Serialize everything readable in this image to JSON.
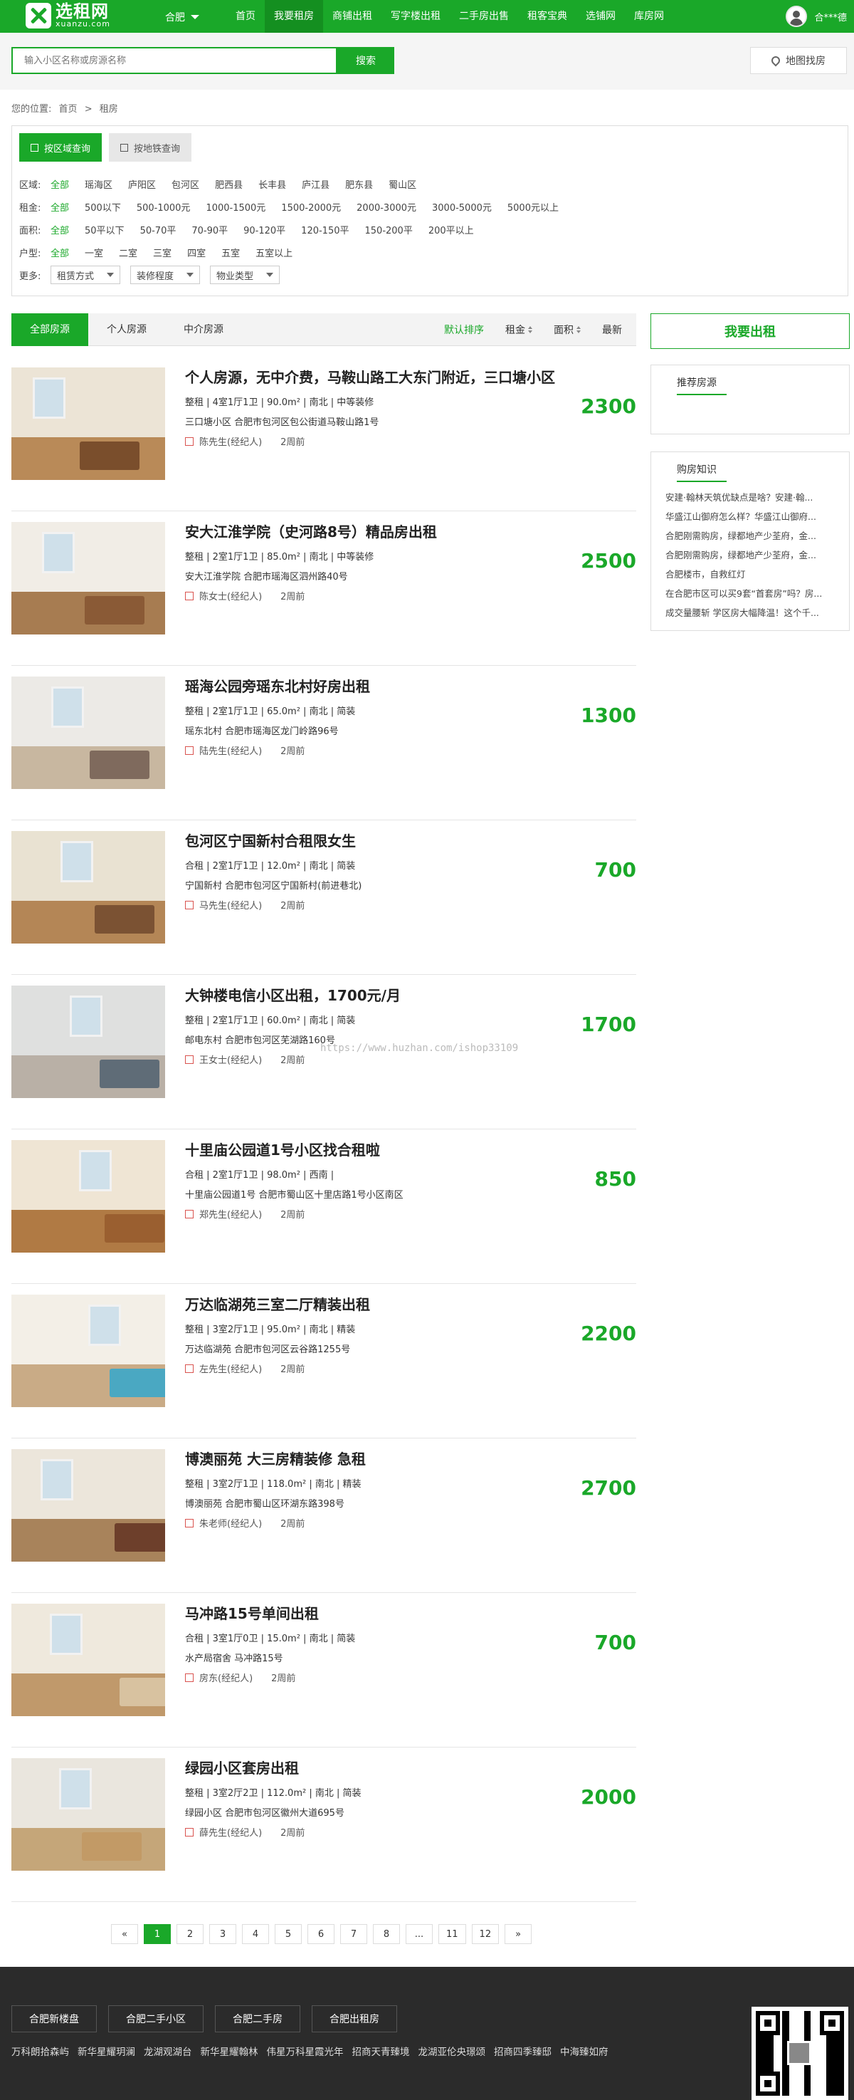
{
  "header": {
    "logo_text": "选租网",
    "logo_domain": "xuanzu.com",
    "city": "合肥",
    "nav": [
      "首页",
      "我要租房",
      "商铺出租",
      "写字楼出租",
      "二手房出售",
      "租客宝典",
      "选铺网",
      "库房网"
    ],
    "active_nav": 1,
    "user_name": "合***德"
  },
  "search": {
    "placeholder": "输入小区名称或房源名称",
    "button": "搜索",
    "map_button": "地图找房"
  },
  "breadcrumb": {
    "prefix": "您的位置:",
    "home": "首页",
    "sep": ">",
    "current": "租房"
  },
  "filter": {
    "tabs": [
      "按区域查询",
      "按地铁查询"
    ],
    "rows": [
      {
        "label": "区域:",
        "options": [
          "全部",
          "瑶海区",
          "庐阳区",
          "包河区",
          "肥西县",
          "长丰县",
          "庐江县",
          "肥东县",
          "蜀山区"
        ]
      },
      {
        "label": "租金:",
        "options": [
          "全部",
          "500以下",
          "500-1000元",
          "1000-1500元",
          "1500-2000元",
          "2000-3000元",
          "3000-5000元",
          "5000元以上"
        ]
      },
      {
        "label": "面积:",
        "options": [
          "全部",
          "50平以下",
          "50-70平",
          "70-90平",
          "90-120平",
          "120-150平",
          "150-200平",
          "200平以上"
        ]
      },
      {
        "label": "户型:",
        "options": [
          "全部",
          "一室",
          "二室",
          "三室",
          "四室",
          "五室",
          "五室以上"
        ]
      }
    ],
    "more_label": "更多:",
    "selects": [
      "租赁方式",
      "装修程度",
      "物业类型"
    ]
  },
  "list_header": {
    "tabs": [
      "全部房源",
      "个人房源",
      "中介房源"
    ],
    "sorts": [
      "默认排序",
      "租金",
      "面积",
      "最新"
    ]
  },
  "listings": [
    {
      "title": "个人房源，无中介费，马鞍山路工大东门附近，三口塘小区",
      "meta": "整租 | 4室1厅1卫 | 90.0m² | 南北 | 中等装修",
      "addr": "三口塘小区 合肥市包河区包公街道马鞍山路1号",
      "agent": "陈先生(经纪人)",
      "time": "2周前",
      "price": "2300"
    },
    {
      "title": "安大江淮学院（史河路8号）精品房出租",
      "meta": "整租 | 2室1厅1卫 | 85.0m² | 南北 | 中等装修",
      "addr": "安大江淮学院 合肥市瑶海区泗州路40号",
      "agent": "陈女士(经纪人)",
      "time": "2周前",
      "price": "2500"
    },
    {
      "title": "瑶海公园旁瑶东北村好房出租",
      "meta": "整租 | 2室1厅1卫 | 65.0m² | 南北 | 简装",
      "addr": "瑶东北村 合肥市瑶海区龙门岭路96号",
      "agent": "陆先生(经纪人)",
      "time": "2周前",
      "price": "1300"
    },
    {
      "title": "包河区宁国新村合租限女生",
      "meta": "合租 | 2室1厅1卫 | 12.0m² | 南北 | 简装",
      "addr": "宁国新村 合肥市包河区宁国新村(前进巷北)",
      "agent": "马先生(经纪人)",
      "time": "2周前",
      "price": "700"
    },
    {
      "title": "大钟楼电信小区出租，1700元/月",
      "meta": "整租 | 2室1厅1卫 | 60.0m² | 南北 | 简装",
      "addr": "邮电东村 合肥市包河区芜湖路160号",
      "agent": "王女士(经纪人)",
      "time": "2周前",
      "price": "1700"
    },
    {
      "title": "十里庙公园道1号小区找合租啦",
      "meta": "合租 | 2室1厅1卫 | 98.0m² | 西南 |",
      "addr": "十里庙公园道1号 合肥市蜀山区十里店路1号小区南区",
      "agent": "郑先生(经纪人)",
      "time": "2周前",
      "price": "850"
    },
    {
      "title": "万达临湖苑三室二厅精装出租",
      "meta": "整租 | 3室2厅1卫 | 95.0m² | 南北 | 精装",
      "addr": "万达临湖苑 合肥市包河区云谷路1255号",
      "agent": "左先生(经纪人)",
      "time": "2周前",
      "price": "2200"
    },
    {
      "title": "博澳丽苑 大三房精装修 急租",
      "meta": "整租 | 3室2厅1卫 | 118.0m² | 南北 | 精装",
      "addr": "博澳丽苑 合肥市蜀山区环湖东路398号",
      "agent": "朱老师(经纪人)",
      "time": "2周前",
      "price": "2700"
    },
    {
      "title": "马冲路15号单间出租",
      "meta": "合租 | 3室1厅0卫 | 15.0m² | 南北 | 简装",
      "addr": "水产局宿舍 马冲路15号",
      "agent": "房东(经纪人)",
      "time": "2周前",
      "price": "700"
    },
    {
      "title": "绿园小区套房出租",
      "meta": "整租 | 3室2厅2卫 | 112.0m² | 南北 | 简装",
      "addr": "绿园小区 合肥市包河区徽州大道695号",
      "agent": "薛先生(经纪人)",
      "time": "2周前",
      "price": "2000"
    }
  ],
  "watermark": "https://www.huzhan.com/ishop33109",
  "pagination": [
    "«",
    "1",
    "2",
    "3",
    "4",
    "5",
    "6",
    "7",
    "8",
    "...",
    "11",
    "12",
    "»"
  ],
  "pagination_active": "1",
  "sidebar": {
    "publish_button": "我要出租",
    "recommend_title": "推荐房源",
    "knowledge_title": "购房知识",
    "knowledge_items": [
      "安建·翰林天筑优缺点是啥？安建·翰...",
      "华盛江山御府怎么样？华盛江山御府...",
      "合肥刚需购房，绿都地产少荃府，金...",
      "合肥刚需购房，绿都地产少荃府，金...",
      "合肥楼市，自救红灯",
      "在合肥市区可以买9套“首套房”吗？房...",
      "成交量腰斩 学区房大幅降温！这个千..."
    ]
  },
  "footer": {
    "tabs": [
      "合肥新楼盘",
      "合肥二手小区",
      "合肥二手房",
      "合肥出租房"
    ],
    "links": [
      "万科朗拾森屿",
      "新华星耀玥澜",
      "龙湖观湖台",
      "新华星耀翰林",
      "伟星万科星霞光年",
      "招商天青臻境",
      "龙湖亚伦央璟颂",
      "招商四季臻邸",
      "中海臻如府"
    ]
  },
  "colors": {
    "brand": "#1aa829",
    "footer_bg": "#2b2b2b"
  }
}
